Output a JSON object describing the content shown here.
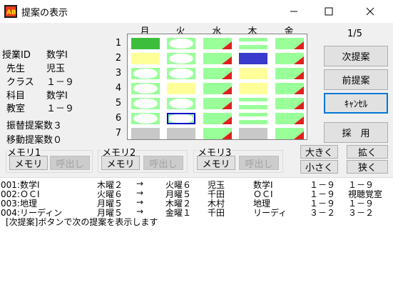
{
  "window": {
    "title": "提案の表示"
  },
  "info": {
    "rows": [
      {
        "label": "授業ID",
        "value": "数学Ⅰ"
      },
      {
        "label": "先生",
        "value": "児玉"
      },
      {
        "label": "クラス",
        "value": "１－９"
      },
      {
        "label": "科目",
        "value": "数学Ⅰ"
      },
      {
        "label": "教室",
        "value": "１－９"
      }
    ],
    "swap_count": "振替提案数３",
    "move_count": "移動提案数０"
  },
  "days": [
    "月",
    "火",
    "水",
    "木",
    "金"
  ],
  "periods": [
    "1",
    "2",
    "3",
    "4",
    "5",
    "6",
    "7"
  ],
  "grid": [
    [
      "green",
      "ellipse",
      "flag",
      "stripe",
      "flag"
    ],
    [
      "yellow",
      "ellipse",
      "flag",
      "blue",
      "flag"
    ],
    [
      "ellipse",
      "ellipse",
      "flag",
      "yellow",
      "flag"
    ],
    [
      "ellipse",
      "yellow",
      "flag",
      "yellow",
      "flag"
    ],
    [
      "ellipse",
      "ellipse",
      "flag",
      "stripe",
      "flag"
    ],
    [
      "ellipse",
      "ellipse-selected",
      "flag",
      "stripe",
      "flag"
    ],
    [
      "gray",
      "gray",
      "flag",
      "gray",
      "flag"
    ]
  ],
  "colors": {
    "green": "#3cbe3c",
    "lightgreen": "#99ff99",
    "yellow": "#ffff99",
    "blue": "#3a3acc",
    "red": "#e02020",
    "gray": "#c8c8c8",
    "select": "#0000cc"
  },
  "pager": "1/5",
  "buttons": {
    "next": "次提案",
    "prev": "前提案",
    "cancel": "ｷｬﾝｾﾙ",
    "adopt": "採　用",
    "larger": "大きく",
    "smaller": "小さく",
    "widen": "拡く",
    "narrow": "狭く"
  },
  "memories": [
    {
      "title": "メモリ1",
      "memo": "メモリ",
      "recall": "呼出し"
    },
    {
      "title": "メモリ2",
      "memo": "メモリ",
      "recall": "呼出し"
    },
    {
      "title": "メモリ3",
      "memo": "メモリ",
      "recall": "呼出し"
    }
  ],
  "proposals": [
    {
      "c0": "001:数学Ⅰ",
      "c1": "木曜２",
      "c2": "→",
      "c3": "火曜６",
      "c4": "児玉",
      "c5": "数学Ⅰ",
      "c6": "１－９",
      "c7": "１－９"
    },
    {
      "c0": "002:ＯＣⅠ",
      "c1": "火曜６",
      "c2": "→",
      "c3": "月曜５",
      "c4": "千田",
      "c5": "ＯＣⅠ",
      "c6": "１－９",
      "c7": "視聴覚室"
    },
    {
      "c0": "003:地理",
      "c1": "月曜５",
      "c2": "→",
      "c3": "木曜２",
      "c4": "木村",
      "c5": "地理",
      "c6": "１－９",
      "c7": "１－９"
    },
    {
      "c0": "004:リーディン",
      "c1": "月曜５",
      "c2": "→",
      "c3": "金曜１",
      "c4": "千田",
      "c5": "リーディ",
      "c6": "３－２",
      "c7": "３－２"
    }
  ],
  "status": "[次提案]ボタンで次の提案を表示します"
}
